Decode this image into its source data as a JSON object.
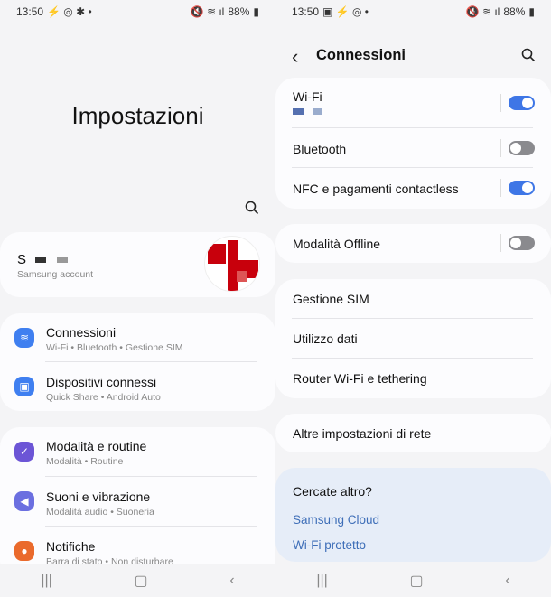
{
  "left": {
    "status": {
      "time": "13:50",
      "battery": "88%"
    },
    "title": "Impostazioni",
    "account": {
      "name_initial": "S",
      "subtitle": "Samsung account"
    },
    "groups": [
      [
        {
          "title": "Connessioni",
          "sub": "Wi-Fi • Bluetooth • Gestione SIM",
          "icon": "wifi-icon",
          "color": "#3f7ff0"
        },
        {
          "title": "Dispositivi connessi",
          "sub": "Quick Share • Android Auto",
          "icon": "devices-icon",
          "color": "#3f7ff0"
        }
      ],
      [
        {
          "title": "Modalità e routine",
          "sub": "Modalità • Routine",
          "icon": "check-circle-icon",
          "color": "#6c55d6"
        },
        {
          "title": "Suoni e vibrazione",
          "sub": "Modalità audio • Suoneria",
          "icon": "speaker-icon",
          "color": "#6b6fe0"
        },
        {
          "title": "Notifiche",
          "sub": "Barra di stato • Non disturbare",
          "icon": "notification-icon",
          "color": "#ea6a2c"
        }
      ]
    ]
  },
  "right": {
    "status": {
      "time": "13:50",
      "battery": "88%"
    },
    "header": {
      "title": "Connessioni"
    },
    "toggles": [
      {
        "label": "Wi-Fi",
        "on": true
      },
      {
        "label": "Bluetooth",
        "on": false
      },
      {
        "label": "NFC e pagamenti contactless",
        "on": true
      },
      {
        "label": "Modalità Offline",
        "on": false
      }
    ],
    "items": [
      "Gestione SIM",
      "Utilizzo dati",
      "Router Wi-Fi e tethering",
      "Altre impostazioni di rete"
    ],
    "more": {
      "title": "Cercate altro?",
      "links": [
        "Samsung Cloud",
        "Wi-Fi protetto"
      ]
    }
  },
  "colors": {
    "accent": "#3e76e6",
    "link": "#3e6eb8",
    "suggest_bg": "#e6edf8"
  }
}
